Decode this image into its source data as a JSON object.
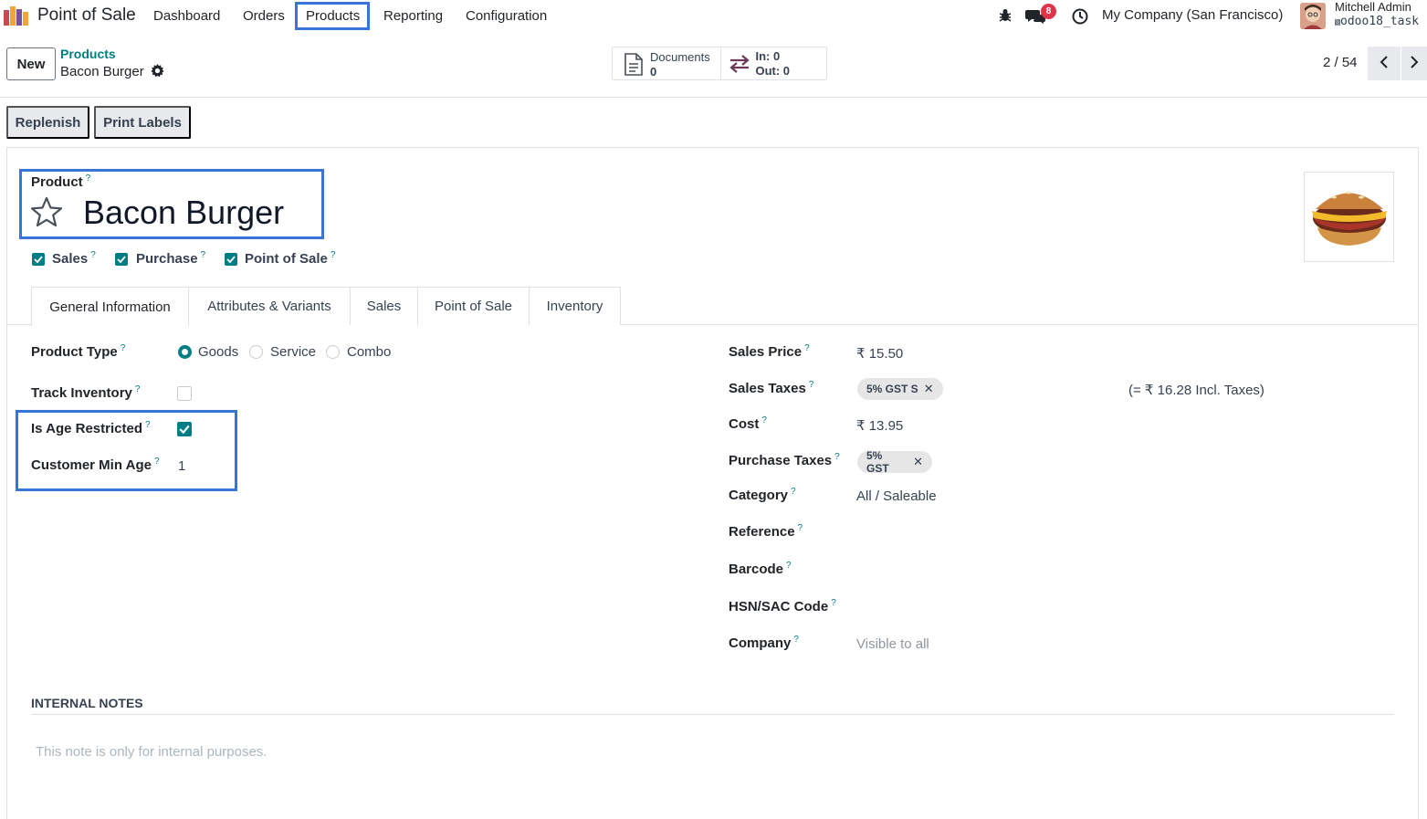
{
  "navbar": {
    "app_name": "Point of Sale",
    "menu": [
      "Dashboard",
      "Orders",
      "Products",
      "Reporting",
      "Configuration"
    ],
    "active_menu": "Products",
    "messages_badge": "8",
    "company": "My Company (San Francisco)",
    "user_name": "Mitchell Admin",
    "db_name": "odoo18_task"
  },
  "control_panel": {
    "new_label": "New",
    "breadcrumb_parent": "Products",
    "breadcrumb_current": "Bacon Burger",
    "smart_buttons": {
      "documents_label": "Documents",
      "documents_count": "0",
      "in_label": "In: 0",
      "out_label": "Out: 0"
    },
    "pager": "2 / 54"
  },
  "status_bar": {
    "replenish_label": "Replenish",
    "print_labels_label": "Print Labels"
  },
  "form": {
    "product_label": "Product",
    "product_name": "Bacon Burger",
    "checkboxes": [
      {
        "label": "Sales",
        "checked": true
      },
      {
        "label": "Purchase",
        "checked": true
      },
      {
        "label": "Point of Sale",
        "checked": true
      }
    ],
    "tabs": [
      "General Information",
      "Attributes & Variants",
      "Sales",
      "Point of Sale",
      "Inventory"
    ],
    "active_tab": "General Information",
    "left": {
      "product_type_label": "Product Type",
      "product_type_options": [
        "Goods",
        "Service",
        "Combo"
      ],
      "product_type_selected": "Goods",
      "track_inventory_label": "Track Inventory",
      "track_inventory": false,
      "age_restricted_label": "Is Age Restricted",
      "age_restricted": true,
      "min_age_label": "Customer Min Age",
      "min_age": "1"
    },
    "right": {
      "sales_price_label": "Sales Price",
      "sales_price": "₹ 15.50",
      "sales_taxes_label": "Sales Taxes",
      "sales_taxes_tag": "5% GST S",
      "incl_taxes": "(= ₹ 16.28 Incl. Taxes)",
      "cost_label": "Cost",
      "cost": "₹ 13.95",
      "purchase_taxes_label": "Purchase Taxes",
      "purchase_taxes_tag": "5% GST",
      "category_label": "Category",
      "category": "All / Saleable",
      "reference_label": "Reference",
      "barcode_label": "Barcode",
      "hsn_label": "HSN/SAC Code",
      "company_label": "Company",
      "company_placeholder": "Visible to all"
    },
    "notes_title": "INTERNAL NOTES",
    "notes_placeholder": "This note is only for internal purposes."
  },
  "colors": {
    "accent": "#017e84",
    "highlight_box": "#3b74d9",
    "badge": "#e0344a"
  }
}
